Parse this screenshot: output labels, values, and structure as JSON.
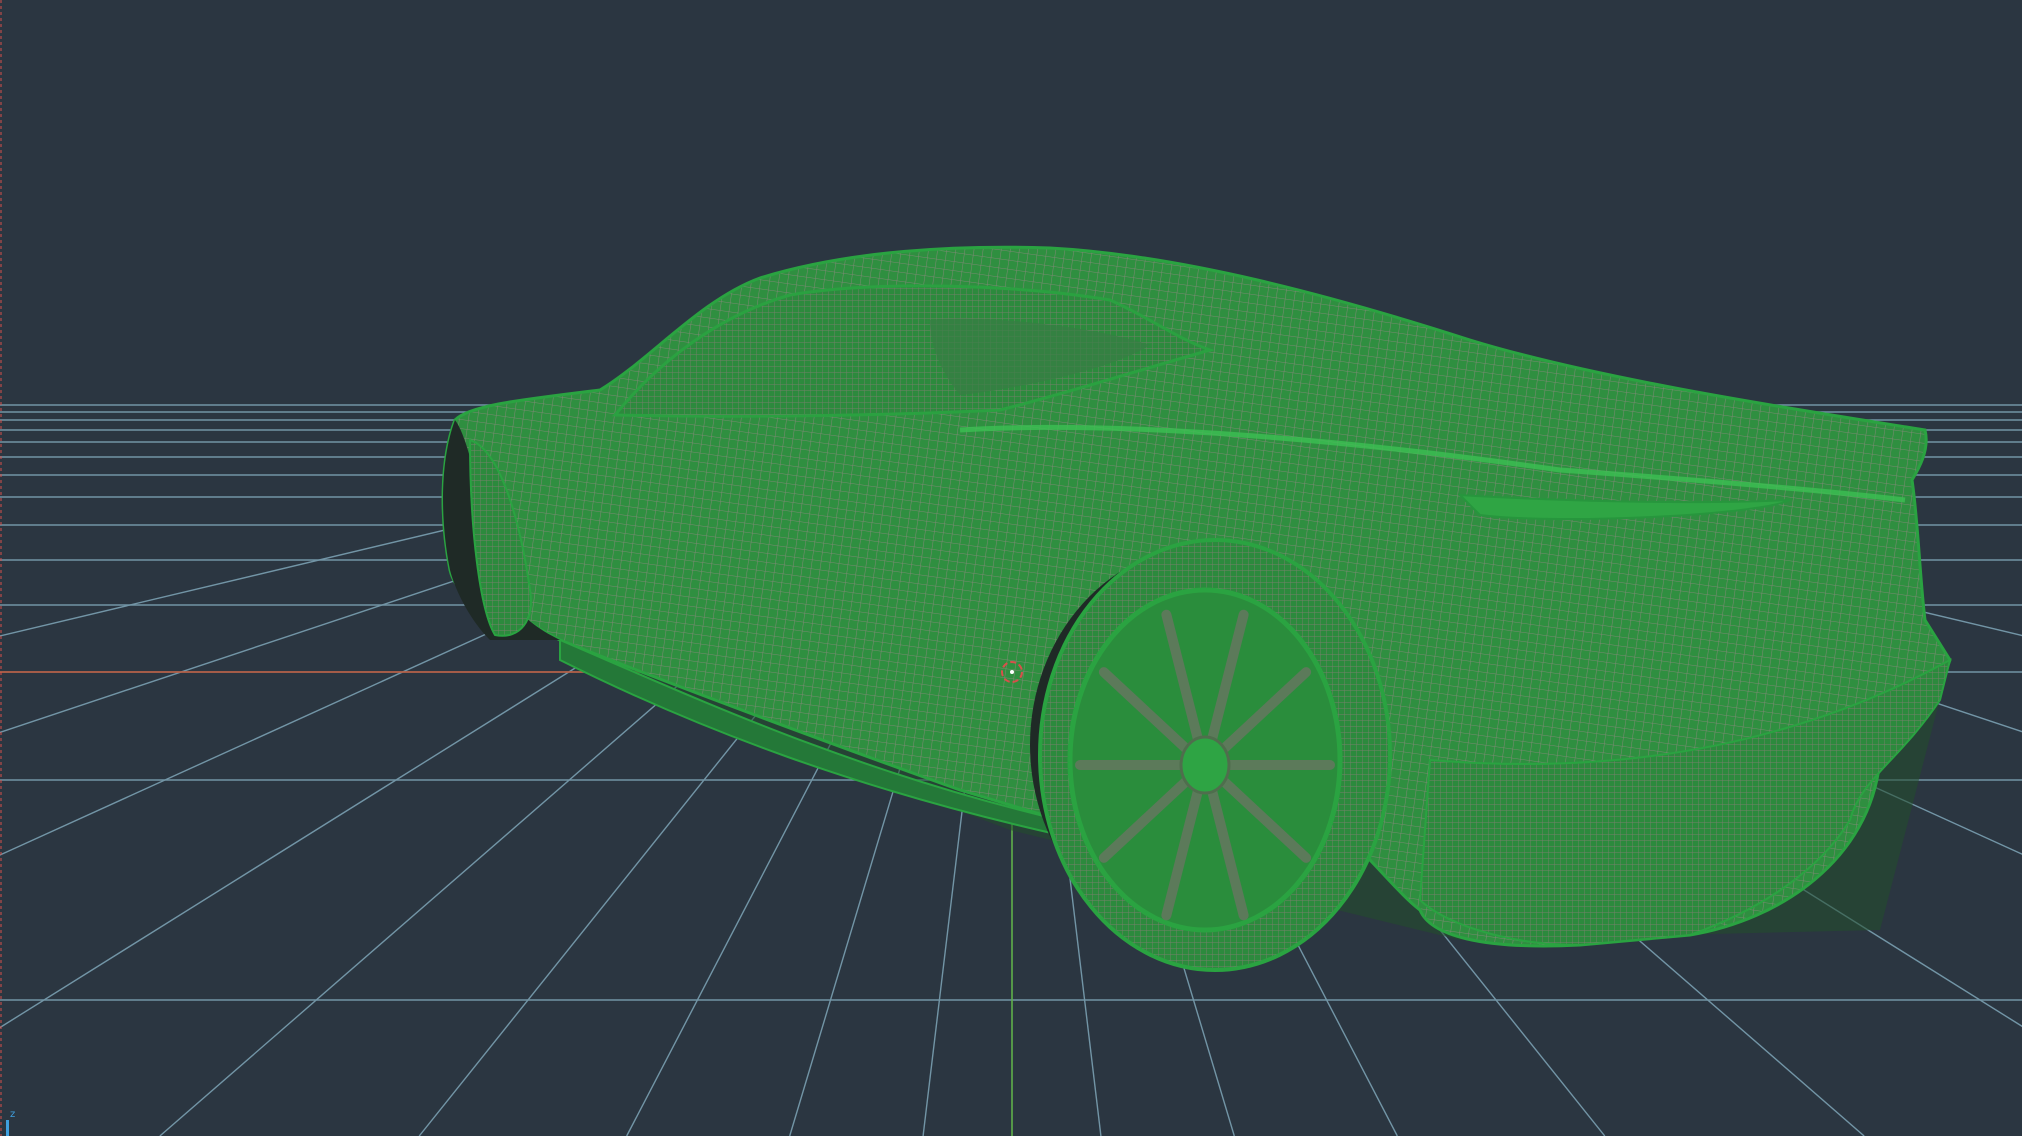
{
  "viewport": {
    "shading": "wireframe",
    "subject": "car-model",
    "colors": {
      "background": "#2b3641",
      "grid": "#7fa6b8",
      "x_axis": "#c05a3a",
      "y_axis": "#5fb04a",
      "edge_marker": "#d8504a",
      "model_fill": "#2f8f40",
      "model_wire": "#7a8a72",
      "model_shadow": "#224f2c",
      "pivot": "#d8504a"
    }
  },
  "axis_gizmo": {
    "label": "z",
    "color": "#3fa0e0"
  }
}
